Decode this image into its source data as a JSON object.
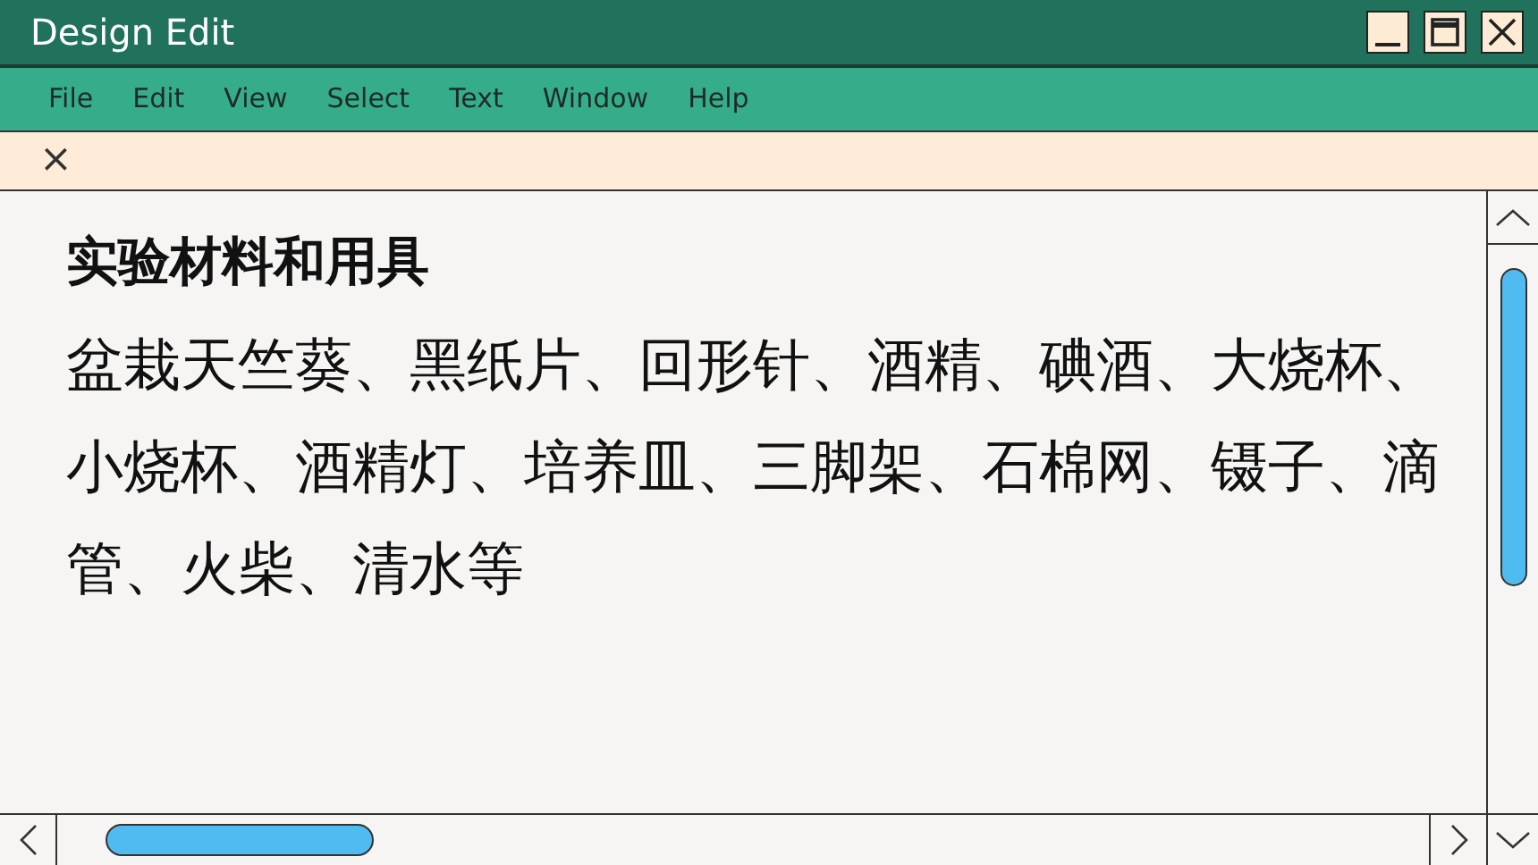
{
  "window": {
    "title": "Design Edit",
    "controls": [
      {
        "kind": "minimize"
      },
      {
        "kind": "maximize"
      },
      {
        "kind": "close"
      }
    ]
  },
  "menu": [
    "File",
    "Edit",
    "View",
    "Select",
    "Text",
    "Window",
    "Help"
  ],
  "tab_bar": {
    "close": "×"
  },
  "document": {
    "heading": "实验材料和用具",
    "body": "盆栽天竺葵、黑纸片、回形针、酒精、碘酒、大烧杯、小烧杯、酒精灯、培养皿、三脚架、石棉网、镊子、滴管、火柴、清水等"
  }
}
